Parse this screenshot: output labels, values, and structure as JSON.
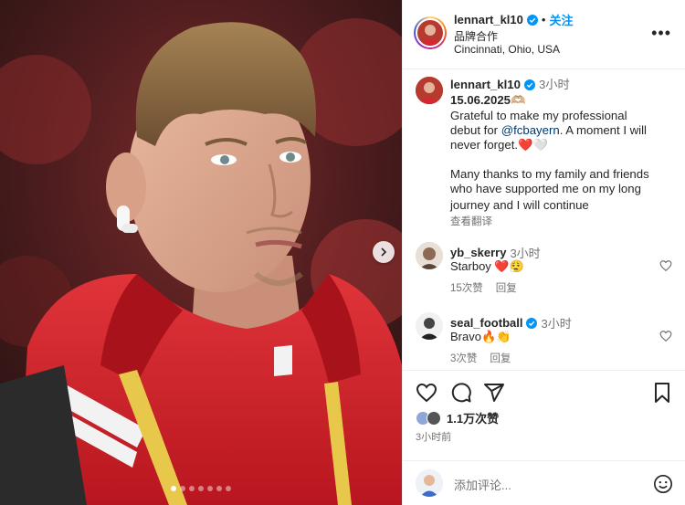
{
  "post_header": {
    "username": "lennart_kl10",
    "follow_label": "关注",
    "subtitle": "品牌合作",
    "location": "Cincinnati, Ohio, USA"
  },
  "caption": {
    "username": "lennart_kl10",
    "time": "3小时",
    "date_line": "15.06.2025🫶🏼",
    "lines": [
      "Grateful to make my professional",
      "debut for ",
      "never forget.❤️🤍",
      "",
      "Many thanks to my family and friends",
      "who have supported me on my long",
      "journey and I will continue"
    ],
    "mention": "@fcbayern",
    "after_mention": ". A moment I will",
    "translate_label": "查看翻译"
  },
  "comments": [
    {
      "username": "yb_skerry",
      "time": "3小时",
      "text": "Starboy ❤️😮‍💨",
      "likes": "15次赞",
      "reply_label": "回复",
      "verified": false
    },
    {
      "username": "seal_football",
      "time": "3小时",
      "text": "Bravo🔥👏",
      "likes": "3次赞",
      "reply_label": "回复",
      "verified": true
    }
  ],
  "actions": {
    "icons": [
      "heart-icon",
      "comment-icon",
      "share-icon",
      "bookmark-icon"
    ],
    "likes_count": "1.1万次赞",
    "time_ago": "3小时前"
  },
  "add_comment": {
    "placeholder": "添加评论..."
  },
  "carousel": {
    "slide_count": 7,
    "active_index": 0
  },
  "colors": {
    "verified": "#0095f6",
    "link": "#00376b",
    "follow": "#0095f6",
    "jersey_red": "#d6262f"
  }
}
